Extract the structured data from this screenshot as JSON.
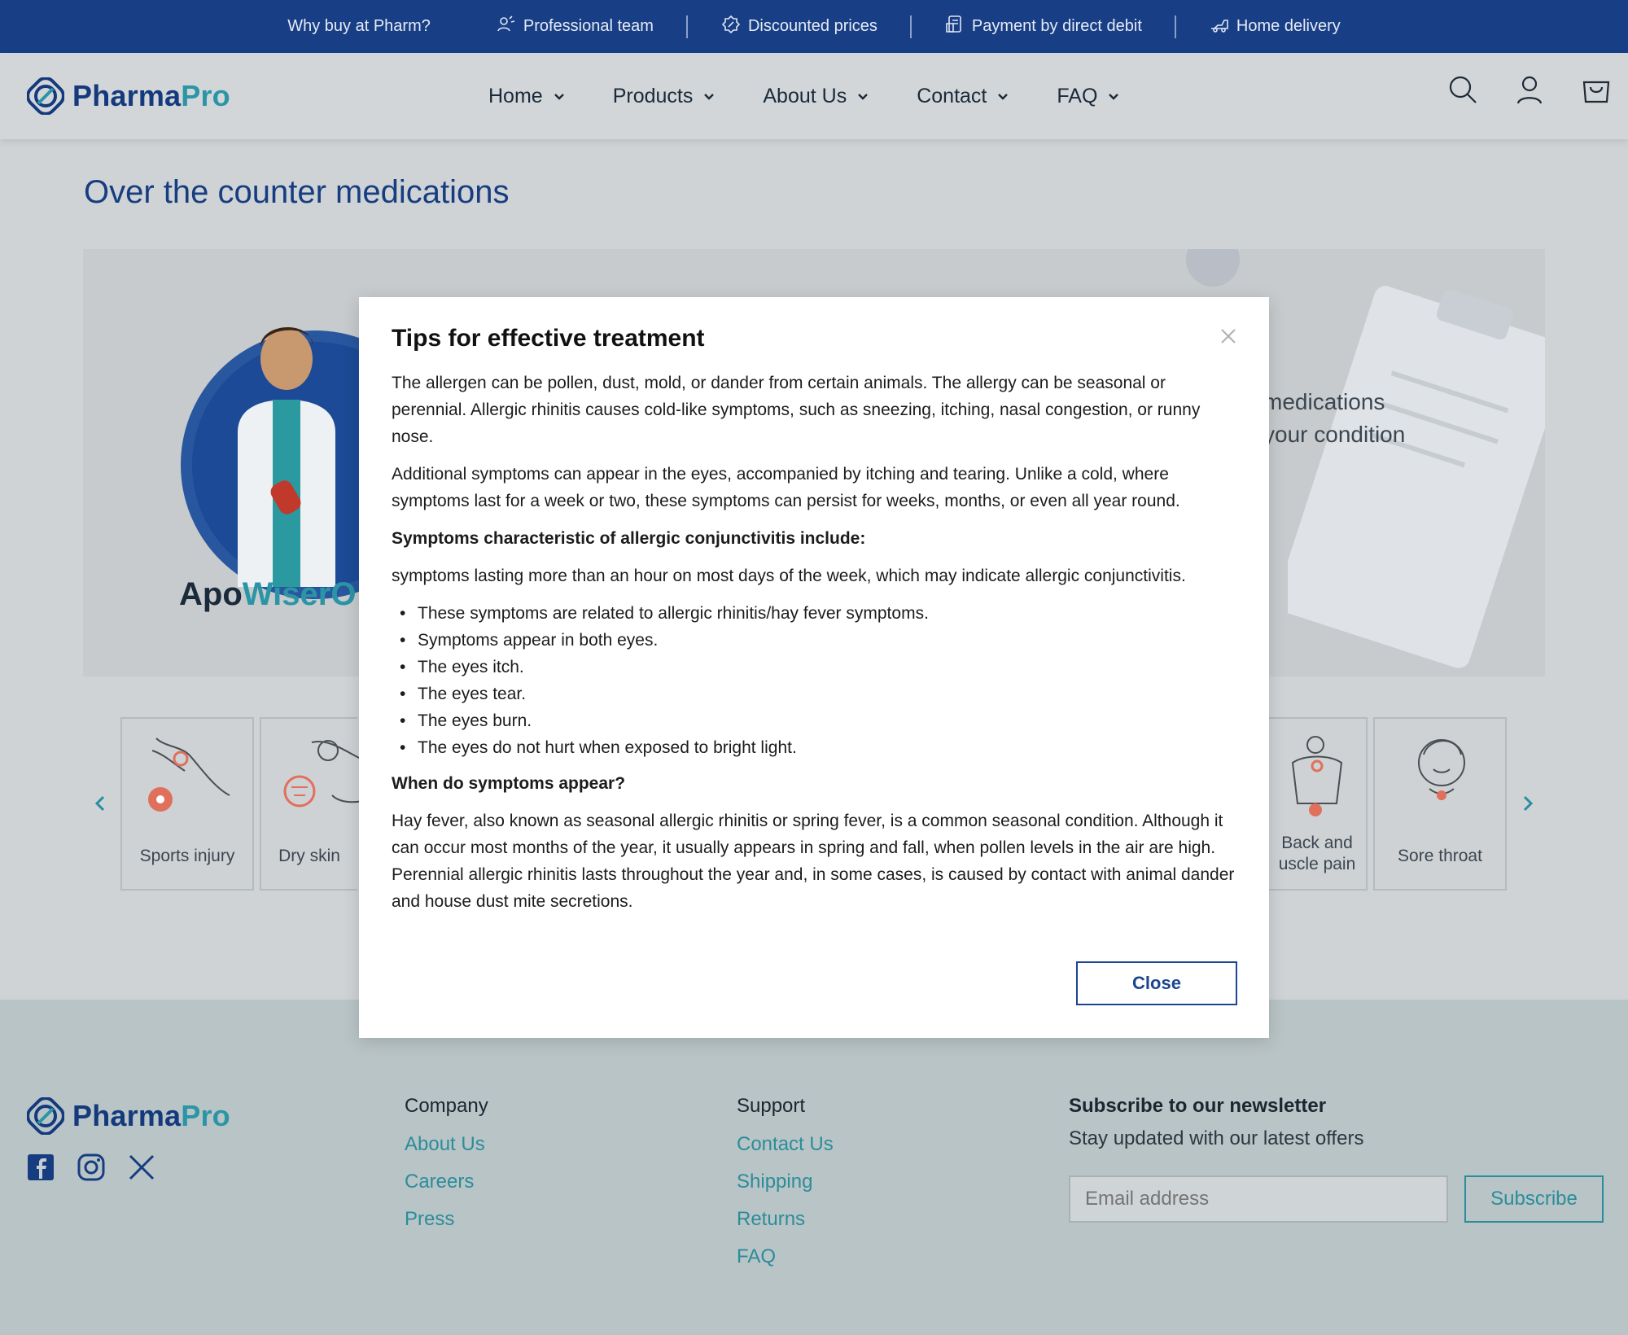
{
  "topbar": {
    "items": [
      {
        "label": "Why buy at Pharm?",
        "icon": ""
      },
      {
        "label": "Professional team",
        "icon": "team-icon"
      },
      {
        "label": "Discounted prices",
        "icon": "discount-icon"
      },
      {
        "label": "Payment by direct debit",
        "icon": "payment-icon"
      },
      {
        "label": "Home delivery",
        "icon": "delivery-icon"
      }
    ]
  },
  "header": {
    "brand_a": "Pharma",
    "brand_b": "Pro",
    "nav": [
      {
        "label": "Home"
      },
      {
        "label": "Products"
      },
      {
        "label": "About Us"
      },
      {
        "label": "Contact"
      },
      {
        "label": "FAQ"
      }
    ],
    "icons": [
      "search-icon",
      "account-icon",
      "cart-icon"
    ]
  },
  "page": {
    "title": "Over the counter medications"
  },
  "hero": {
    "brand_a": "Apo",
    "brand_b": "Wiser",
    "brand_c": "O",
    "copy_line1": "medications",
    "copy_line2": "your condition"
  },
  "categories": [
    {
      "label": "Sports injury",
      "icon": "sports-injury-icon"
    },
    {
      "label": "Dry skin",
      "icon": "dry-skin-icon"
    },
    {
      "label_line1": "Back and",
      "label_line2": "uscle pain",
      "icon": "back-pain-icon"
    },
    {
      "label": "Sore throat",
      "icon": "sore-throat-icon"
    }
  ],
  "modal": {
    "title": "Tips for effective treatment",
    "p1": "The allergen can be pollen, dust, mold, or dander from certain animals. The allergy can be seasonal or perennial. Allergic rhinitis causes cold-like symptoms, such as sneezing, itching, nasal congestion, or runny nose.",
    "p2": "Additional symptoms can appear in the eyes, accompanied by itching and tearing. Unlike a cold, where symptoms last for a week or two, these symptoms can persist for weeks, months, or even all year round.",
    "h1": "Symptoms characteristic of allergic conjunctivitis include:",
    "p3": "symptoms lasting more than an hour on most days of the week, which may indicate allergic conjunctivitis.",
    "bullets": [
      "These symptoms are related to allergic rhinitis/hay fever symptoms.",
      "Symptoms appear in both eyes.",
      "The eyes itch.",
      "The eyes tear.",
      "The eyes burn.",
      "The eyes do not hurt when exposed to bright light."
    ],
    "h2": "When do symptoms appear?",
    "p4": "Hay fever, also known as seasonal allergic rhinitis or spring fever, is a common seasonal condition. Although it can occur most months of the year, it usually appears in spring and fall, when pollen levels in the air are high. Perennial allergic rhinitis lasts throughout the year and, in some cases, is caused by contact with animal dander and house dust mite secretions.",
    "close_label": "Close"
  },
  "footer": {
    "brand_a": "Pharma",
    "brand_b": "Pro",
    "company_title": "Company",
    "company_links": [
      "About Us",
      "Careers",
      "Press"
    ],
    "support_title": "Support",
    "support_links": [
      "Contact Us",
      "Shipping",
      "Returns",
      "FAQ"
    ],
    "newsletter_title": "Subscribe to our newsletter",
    "newsletter_sub": "Stay updated with our latest offers",
    "email_placeholder": "Email address",
    "subscribe_label": "Subscribe"
  },
  "colors": {
    "brand_navy": "#183f86",
    "brand_teal": "#2b95a6",
    "overlay_bg": "#cfd3d5"
  }
}
